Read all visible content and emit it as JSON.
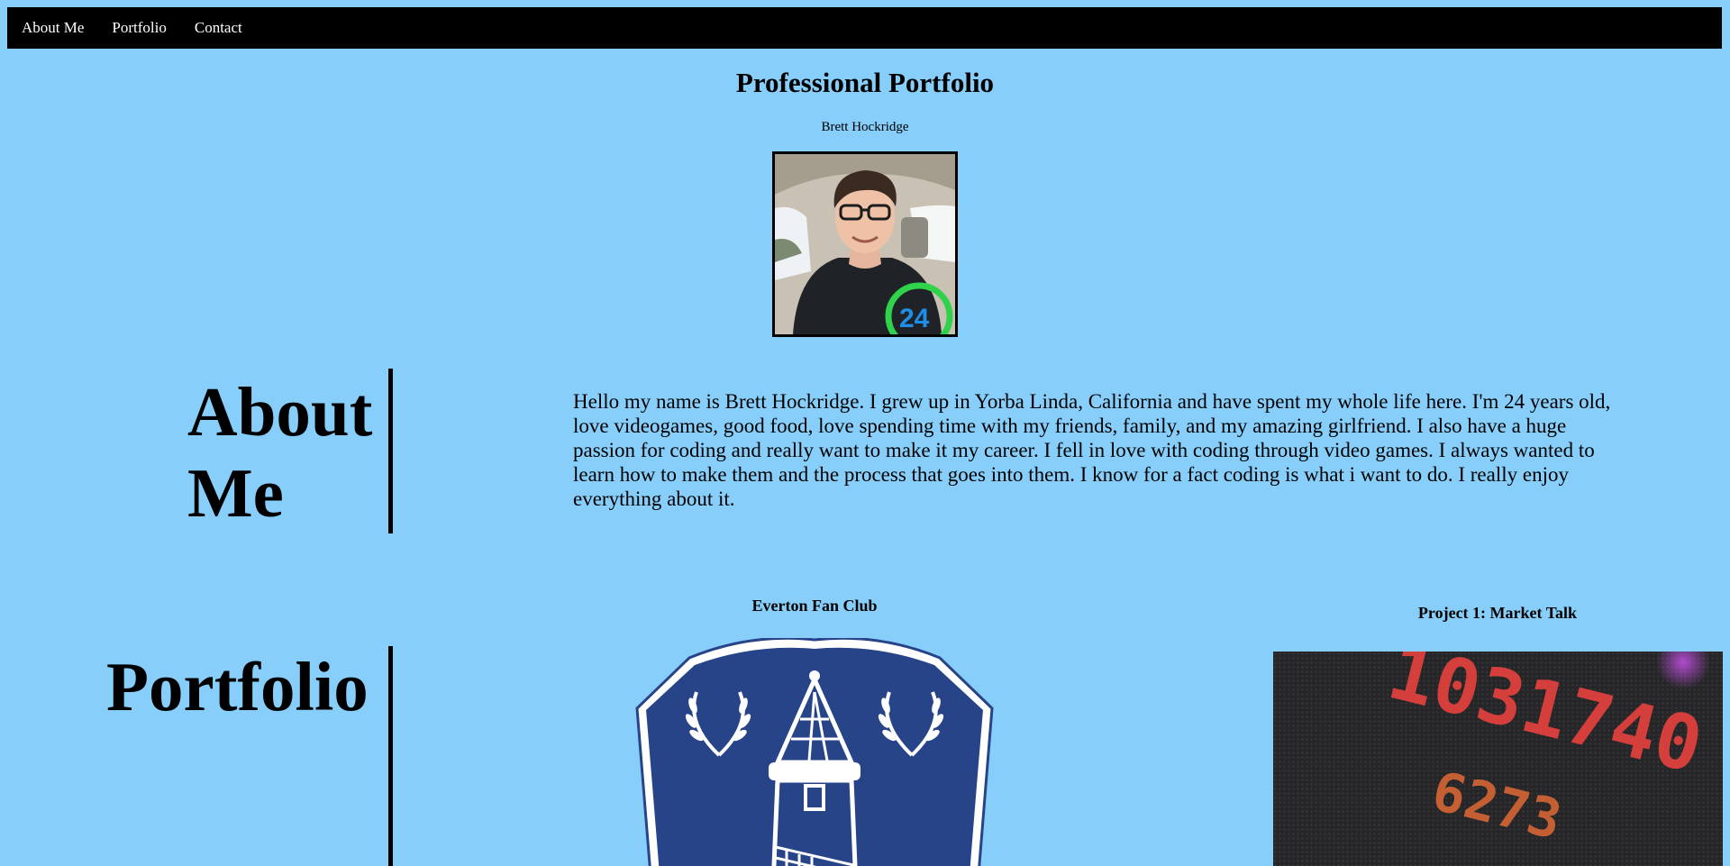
{
  "nav": {
    "items": [
      {
        "label": "About Me"
      },
      {
        "label": "Portfolio"
      },
      {
        "label": "Contact"
      }
    ]
  },
  "header": {
    "title": "Professional Portfolio",
    "author": "Brett Hockridge"
  },
  "profile_photo": {
    "shirt_number": "24"
  },
  "about": {
    "heading": "About Me",
    "body": "Hello my name is Brett Hockridge. I grew up in Yorba Linda, California and have spent my whole life here. I'm 24 years old, love videogames, good food, love spending time with my friends, family, and my amazing girlfriend. I also have a huge passion for coding and really want to make it my career. I fell in love with coding through video games. I always wanted to learn how to make them and the process that goes into them. I know for a fact coding is what i want to do. I really enjoy everything about it."
  },
  "portfolio": {
    "heading": "Portfolio",
    "projects": [
      {
        "title": "Everton Fan Club",
        "image_icon": "everton-crest-icon"
      },
      {
        "title": "Project 1: Market Talk",
        "image_icon": "stock-ticker-image",
        "ticker_line_1": "1031740",
        "ticker_line_2": "6273"
      }
    ]
  },
  "colors": {
    "background": "#87cefa",
    "nav_background": "#000000",
    "nav_text": "#ffffff",
    "crest_blue": "#274488",
    "ticker_red": "#e8423e"
  }
}
